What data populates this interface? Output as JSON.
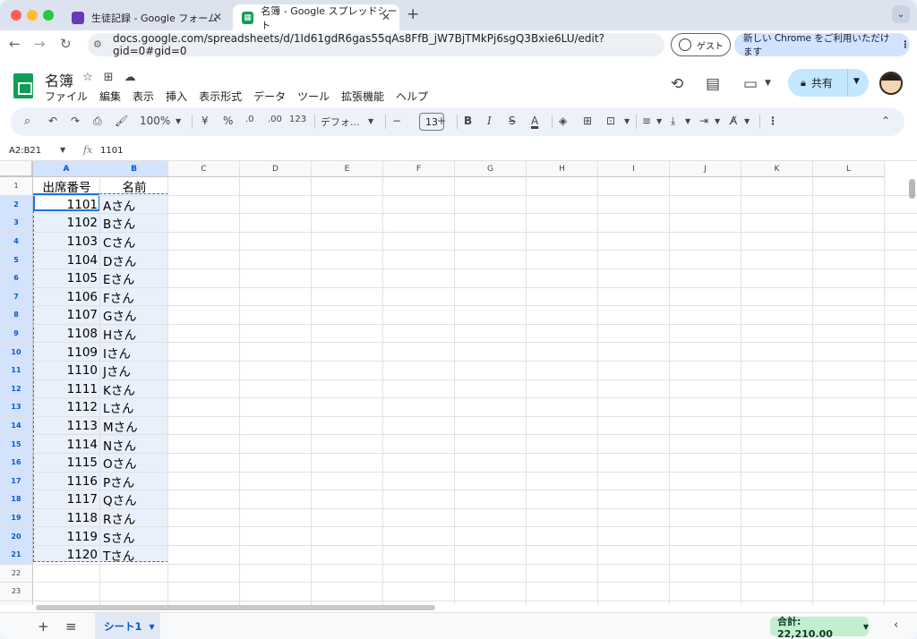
{
  "browser": {
    "tabs": [
      {
        "title": "生徒記録 - Google フォーム",
        "favicon_color": "#673ab7",
        "active": false
      },
      {
        "title": "名簿 - Google スプレッドシート",
        "favicon_color": "#0f9d58",
        "active": true
      }
    ],
    "url": "docs.google.com/spreadsheets/d/1Id61gdR6gas55qAs8FfB_jW7BjTMkPj6sgQ3Bxie6LU/edit?gid=0#gid=0",
    "guest_label": "ゲスト",
    "promo_label": "新しい Chrome をご利用いただけます"
  },
  "doc": {
    "title": "名簿",
    "menu": [
      "ファイル",
      "編集",
      "表示",
      "挿入",
      "表示形式",
      "データ",
      "ツール",
      "拡張機能",
      "ヘルプ"
    ],
    "share_label": "共有"
  },
  "toolbar": {
    "zoom": "100%",
    "currency": "¥",
    "percent": "%",
    "dec_decrease": ".0",
    "dec_increase": ".00",
    "number_format": "123",
    "font": "デフォ...",
    "font_size": "13",
    "bold": "B",
    "italic": "I",
    "strike": "S",
    "text_color": "A"
  },
  "formula_bar": {
    "name_box": "A2:B21",
    "fx": "fx",
    "value": "1101"
  },
  "grid": {
    "columns": [
      "A",
      "B",
      "C",
      "D",
      "E",
      "F",
      "G",
      "H",
      "I",
      "J",
      "K",
      "L"
    ],
    "selected_columns": [
      "A",
      "B"
    ],
    "row_numbers": [
      "1",
      "2",
      "3",
      "4",
      "5",
      "6",
      "7",
      "8",
      "9",
      "10",
      "11",
      "12",
      "13",
      "14",
      "15",
      "16",
      "17",
      "18",
      "19",
      "20",
      "21",
      "22",
      "23",
      "24"
    ],
    "header": [
      "出席番号",
      "名前"
    ],
    "rows": [
      [
        "1101",
        "Aさん"
      ],
      [
        "1102",
        "Bさん"
      ],
      [
        "1103",
        "Cさん"
      ],
      [
        "1104",
        "Dさん"
      ],
      [
        "1105",
        "Eさん"
      ],
      [
        "1106",
        "Fさん"
      ],
      [
        "1107",
        "Gさん"
      ],
      [
        "1108",
        "Hさん"
      ],
      [
        "1109",
        "Iさん"
      ],
      [
        "1110",
        "Jさん"
      ],
      [
        "1111",
        "Kさん"
      ],
      [
        "1112",
        "Lさん"
      ],
      [
        "1113",
        "Mさん"
      ],
      [
        "1114",
        "Nさん"
      ],
      [
        "1115",
        "Oさん"
      ],
      [
        "1116",
        "Pさん"
      ],
      [
        "1117",
        "Qさん"
      ],
      [
        "1118",
        "Rさん"
      ],
      [
        "1119",
        "Sさん"
      ],
      [
        "1120",
        "Tさん"
      ]
    ]
  },
  "bottom": {
    "sheet_tab": "シート1",
    "sum": "合計: 22,210.00"
  }
}
